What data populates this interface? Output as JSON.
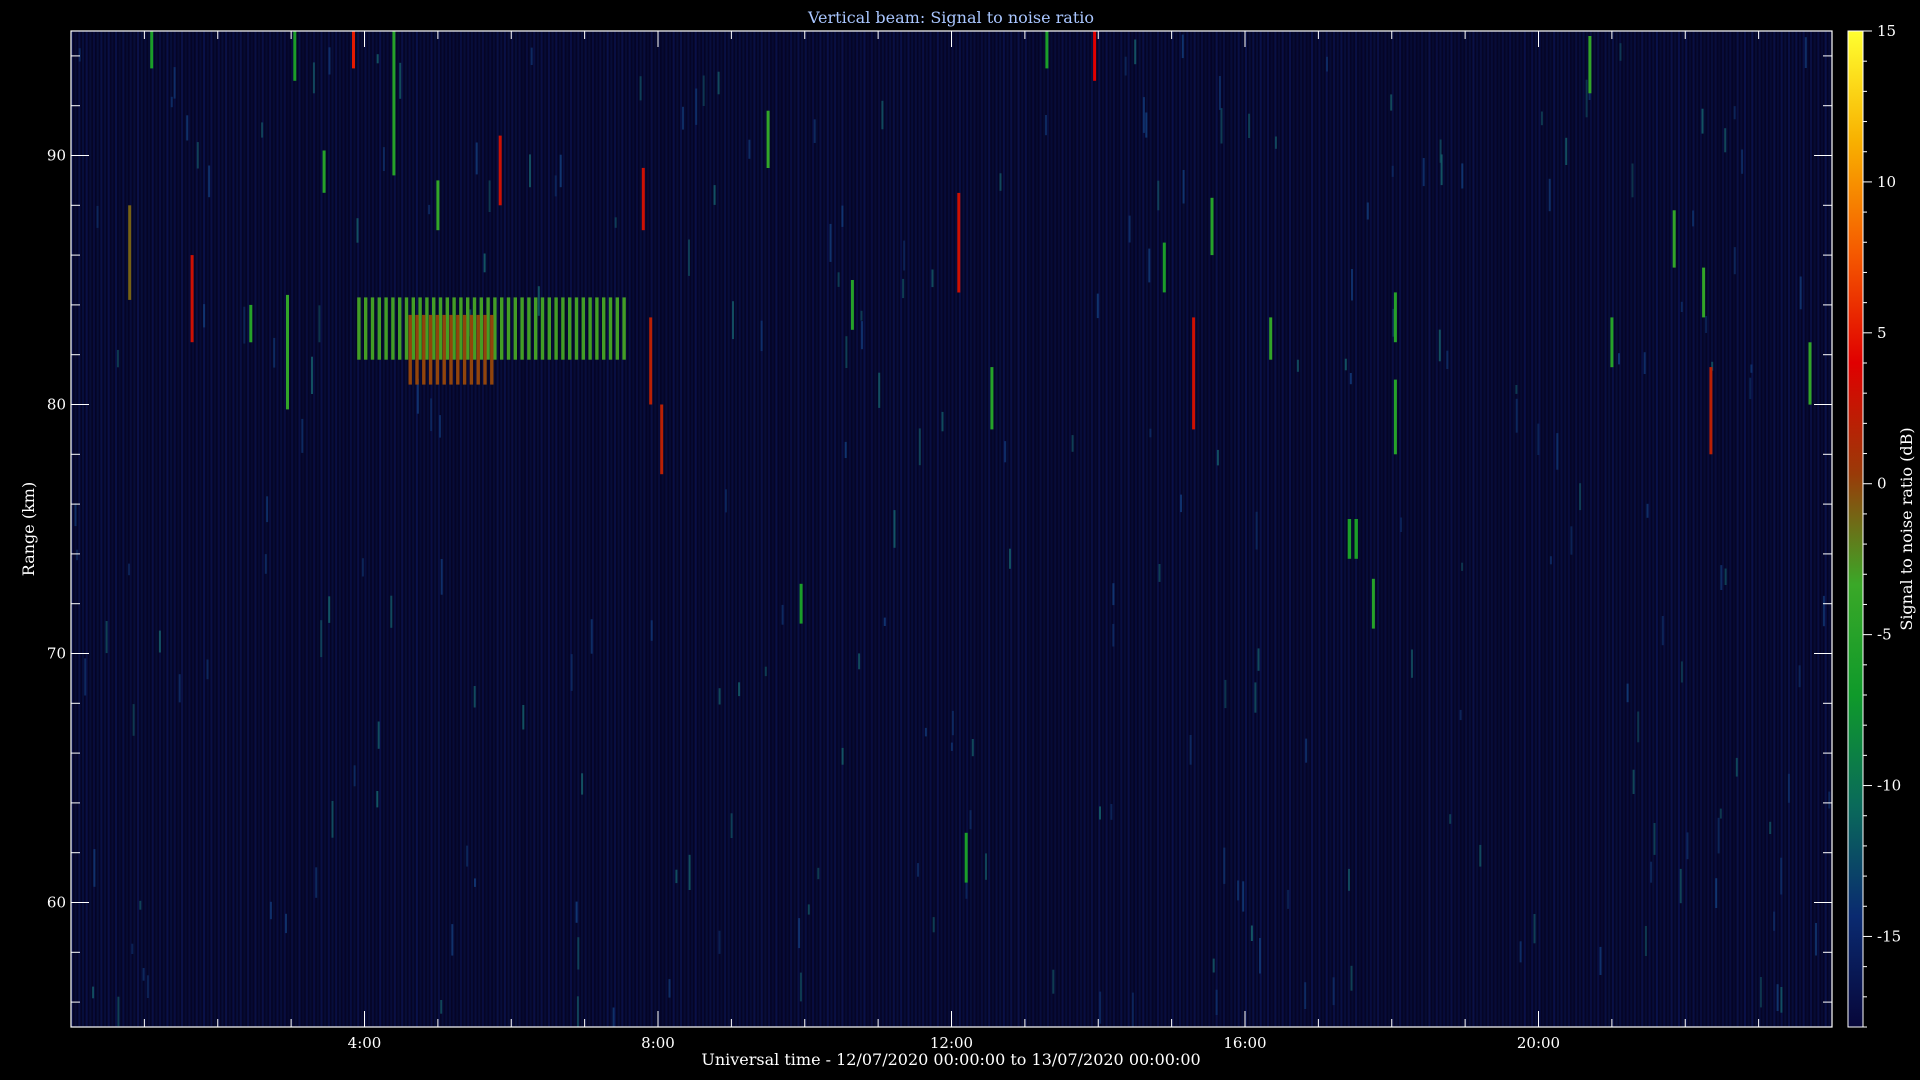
{
  "chart_data": {
    "type": "heatmap",
    "title": "Vertical beam: Signal to noise ratio",
    "xlabel": "Universal time - 12/07/2020 00:00:00 to 13/07/2020 00:00:00",
    "ylabel": "Range (km)",
    "colorbar_label": "Signal to noise ratio (dB)",
    "xlim": [
      0,
      24
    ],
    "ylim": [
      55,
      95
    ],
    "clim": [
      -18,
      15
    ],
    "x_ticks": [
      {
        "value": 4,
        "label": "4:00"
      },
      {
        "value": 8,
        "label": "8:00"
      },
      {
        "value": 12,
        "label": "12:00"
      },
      {
        "value": 16,
        "label": "16:00"
      },
      {
        "value": 20,
        "label": "20:00"
      }
    ],
    "y_ticks": [
      {
        "value": 60,
        "label": "60"
      },
      {
        "value": 70,
        "label": "70"
      },
      {
        "value": 80,
        "label": "80"
      },
      {
        "value": 90,
        "label": "90"
      }
    ],
    "colorbar_ticks": [
      {
        "value": 15,
        "label": "15"
      },
      {
        "value": 10,
        "label": "10"
      },
      {
        "value": 5,
        "label": "5"
      },
      {
        "value": 0,
        "label": "0"
      },
      {
        "value": -5,
        "label": "-5"
      },
      {
        "value": -10,
        "label": "-10"
      },
      {
        "value": -15,
        "label": "-15"
      }
    ],
    "colorscale": [
      "#07073a",
      "#0a2a70",
      "#0a6a5a",
      "#0f9a2a",
      "#3aa828",
      "#9a3a08",
      "#e00000",
      "#f55a00",
      "#f8b000",
      "#ffff30"
    ],
    "grid": false,
    "features": [
      {
        "t_start": 3.9,
        "t_end": 7.6,
        "range_low": 81.8,
        "range_high": 84.3,
        "snr_db": -3
      },
      {
        "t_start": 4.6,
        "t_end": 5.8,
        "range_low": 80.8,
        "range_high": 83.6,
        "snr_db": 0
      },
      {
        "t_start": 17.4,
        "t_end": 17.5,
        "range_low": 73.8,
        "range_high": 75.4,
        "snr_db": -6
      }
    ],
    "echoes": [
      {
        "t": 0.8,
        "range_low": 84.2,
        "range_high": 88.0,
        "snr_db": -1
      },
      {
        "t": 1.65,
        "range_low": 82.5,
        "range_high": 86.0,
        "snr_db": 3
      },
      {
        "t": 1.1,
        "range_low": 93.5,
        "range_high": 95.0,
        "snr_db": -6
      },
      {
        "t": 2.45,
        "range_low": 82.5,
        "range_high": 84.0,
        "snr_db": -5
      },
      {
        "t": 2.95,
        "range_low": 79.8,
        "range_high": 84.4,
        "snr_db": -4
      },
      {
        "t": 3.05,
        "range_low": 93.0,
        "range_high": 95.0,
        "snr_db": -6
      },
      {
        "t": 3.45,
        "range_low": 88.5,
        "range_high": 90.2,
        "snr_db": -5
      },
      {
        "t": 3.85,
        "range_low": 93.5,
        "range_high": 95.0,
        "snr_db": 5
      },
      {
        "t": 4.4,
        "range_low": 89.2,
        "range_high": 95.0,
        "snr_db": -5
      },
      {
        "t": 5.0,
        "range_low": 87.0,
        "range_high": 89.0,
        "snr_db": -4
      },
      {
        "t": 5.85,
        "range_low": 88.0,
        "range_high": 90.8,
        "snr_db": 3
      },
      {
        "t": 7.8,
        "range_low": 87.0,
        "range_high": 89.5,
        "snr_db": 3
      },
      {
        "t": 7.9,
        "range_low": 80.0,
        "range_high": 83.5,
        "snr_db": 2
      },
      {
        "t": 8.05,
        "range_low": 77.2,
        "range_high": 80.0,
        "snr_db": 2
      },
      {
        "t": 9.5,
        "range_low": 89.5,
        "range_high": 91.8,
        "snr_db": -4
      },
      {
        "t": 9.95,
        "range_low": 71.2,
        "range_high": 72.8,
        "snr_db": -6
      },
      {
        "t": 10.65,
        "range_low": 83.0,
        "range_high": 85.0,
        "snr_db": -5
      },
      {
        "t": 12.1,
        "range_low": 84.5,
        "range_high": 88.5,
        "snr_db": 3
      },
      {
        "t": 12.2,
        "range_low": 60.8,
        "range_high": 62.8,
        "snr_db": -6
      },
      {
        "t": 12.55,
        "range_low": 79.0,
        "range_high": 81.5,
        "snr_db": -5
      },
      {
        "t": 13.3,
        "range_low": 93.5,
        "range_high": 95.0,
        "snr_db": -6
      },
      {
        "t": 13.95,
        "range_low": 93.0,
        "range_high": 95.0,
        "snr_db": 4
      },
      {
        "t": 14.9,
        "range_low": 84.5,
        "range_high": 86.5,
        "snr_db": -6
      },
      {
        "t": 15.3,
        "range_low": 79.0,
        "range_high": 83.5,
        "snr_db": 3
      },
      {
        "t": 15.55,
        "range_low": 86.0,
        "range_high": 88.3,
        "snr_db": -5
      },
      {
        "t": 16.35,
        "range_low": 81.8,
        "range_high": 83.5,
        "snr_db": -4
      },
      {
        "t": 17.75,
        "range_low": 71.0,
        "range_high": 73.0,
        "snr_db": -5
      },
      {
        "t": 18.05,
        "range_low": 82.5,
        "range_high": 84.5,
        "snr_db": -5
      },
      {
        "t": 18.05,
        "range_low": 78.0,
        "range_high": 81.0,
        "snr_db": -5
      },
      {
        "t": 20.7,
        "range_low": 92.5,
        "range_high": 94.8,
        "snr_db": -4
      },
      {
        "t": 21.0,
        "range_low": 81.5,
        "range_high": 83.5,
        "snr_db": -5
      },
      {
        "t": 21.85,
        "range_low": 85.5,
        "range_high": 87.8,
        "snr_db": -4
      },
      {
        "t": 22.25,
        "range_low": 83.5,
        "range_high": 85.5,
        "snr_db": -4
      },
      {
        "t": 22.35,
        "range_low": 78.0,
        "range_high": 81.5,
        "snr_db": 2
      },
      {
        "t": 23.7,
        "range_low": 80.0,
        "range_high": 82.5,
        "snr_db": -4
      }
    ]
  }
}
